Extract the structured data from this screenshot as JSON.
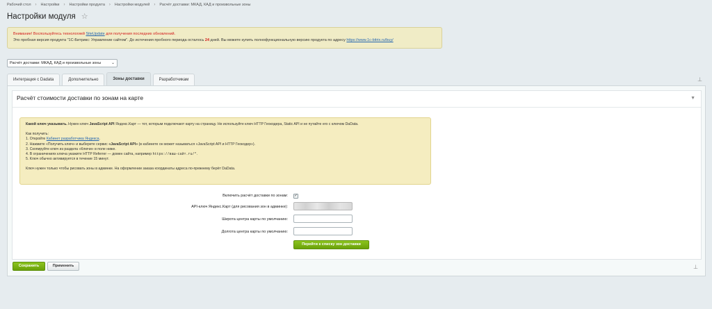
{
  "breadcrumb": [
    "Рабочий стол",
    "Настройки",
    "Настройки продукта",
    "Настройки модулей",
    "Расчёт доставки: МКАД, КАД и произвольные зоны"
  ],
  "page_title": "Настройки модуля",
  "notice": {
    "line1_warn": "Внимание! Воспользуйтесь технологией ",
    "line1_link": "SiteUpdate",
    "line1_tail": " для получения последних обновлений.",
    "line2_pre": "Это пробная версия продукта \"1С-Битрикс: Управление сайтом\". До истечения пробного периода осталось ",
    "days": "24",
    "line2_mid": " дней. Вы можете купить полнофункциональную версию продукта по адресу ",
    "line2_link": "https://www.1c-bitrix.ru/buy/"
  },
  "module_select": {
    "value": "Расчёт доставки: МКАД, КАД и произвольные зоны"
  },
  "tabs": [
    {
      "label": "Интеграция с Dadata"
    },
    {
      "label": "Дополнительно"
    },
    {
      "label": "Зоны доставки",
      "active": true
    },
    {
      "label": "Разработчикам"
    }
  ],
  "section_title": "Расчёт стоимости доставки по зонам на карте",
  "help": {
    "bold1": "Какой ключ указывать.",
    "t1": " Нужен ключ ",
    "bold2": "JavaScript API",
    "t2": " Яндекс.Карт — тот, которым подключают карту на страницу. Не используйте ключ HTTP Геокодера, Static API и не путайте его с ключом DaData.",
    "how": "Как получить:",
    "s1_pre": "1. Откройте ",
    "s1_link": "Кабинет разработчика Яндекса",
    "s1_post": ".",
    "s2_pre": "2. Нажмите «Получить ключ» и выберете сервис ",
    "s2_bold": "«JavaScript API»",
    "s2_post": " (в кабинете он может называться «JavaScript API и HTTP Геокодер»).",
    "s3": "3. Скопируйте ключ из раздела «Ключи» в поле ниже.",
    "s4_pre": "4. В ограничениях ключа укажите HTTP Referrer — домен сайта, например ",
    "s4_code": "https://ваш-сайт.ru/*",
    "s4_post": ".",
    "s5": "5. Ключ обычно активируется в течение 15 минут.",
    "footer": "Ключ нужен только чтобы рисовать зоны в админке. На оформлении заказа координаты адреса по-прежнему берёт DaData."
  },
  "form": {
    "enable_label": "Включить расчёт доставки по зонам:",
    "enable_checked": true,
    "apikey_label": "API-ключ Яндекс.Карт (для рисования зон в админке):",
    "lat_label": "Широта центра карты по умолчанию:",
    "lon_label": "Долгота центра карты по умолчанию:",
    "goto_button": "Перейти к списку зон доставки"
  },
  "footer_buttons": {
    "save": "Сохранить",
    "apply": "Применить"
  }
}
